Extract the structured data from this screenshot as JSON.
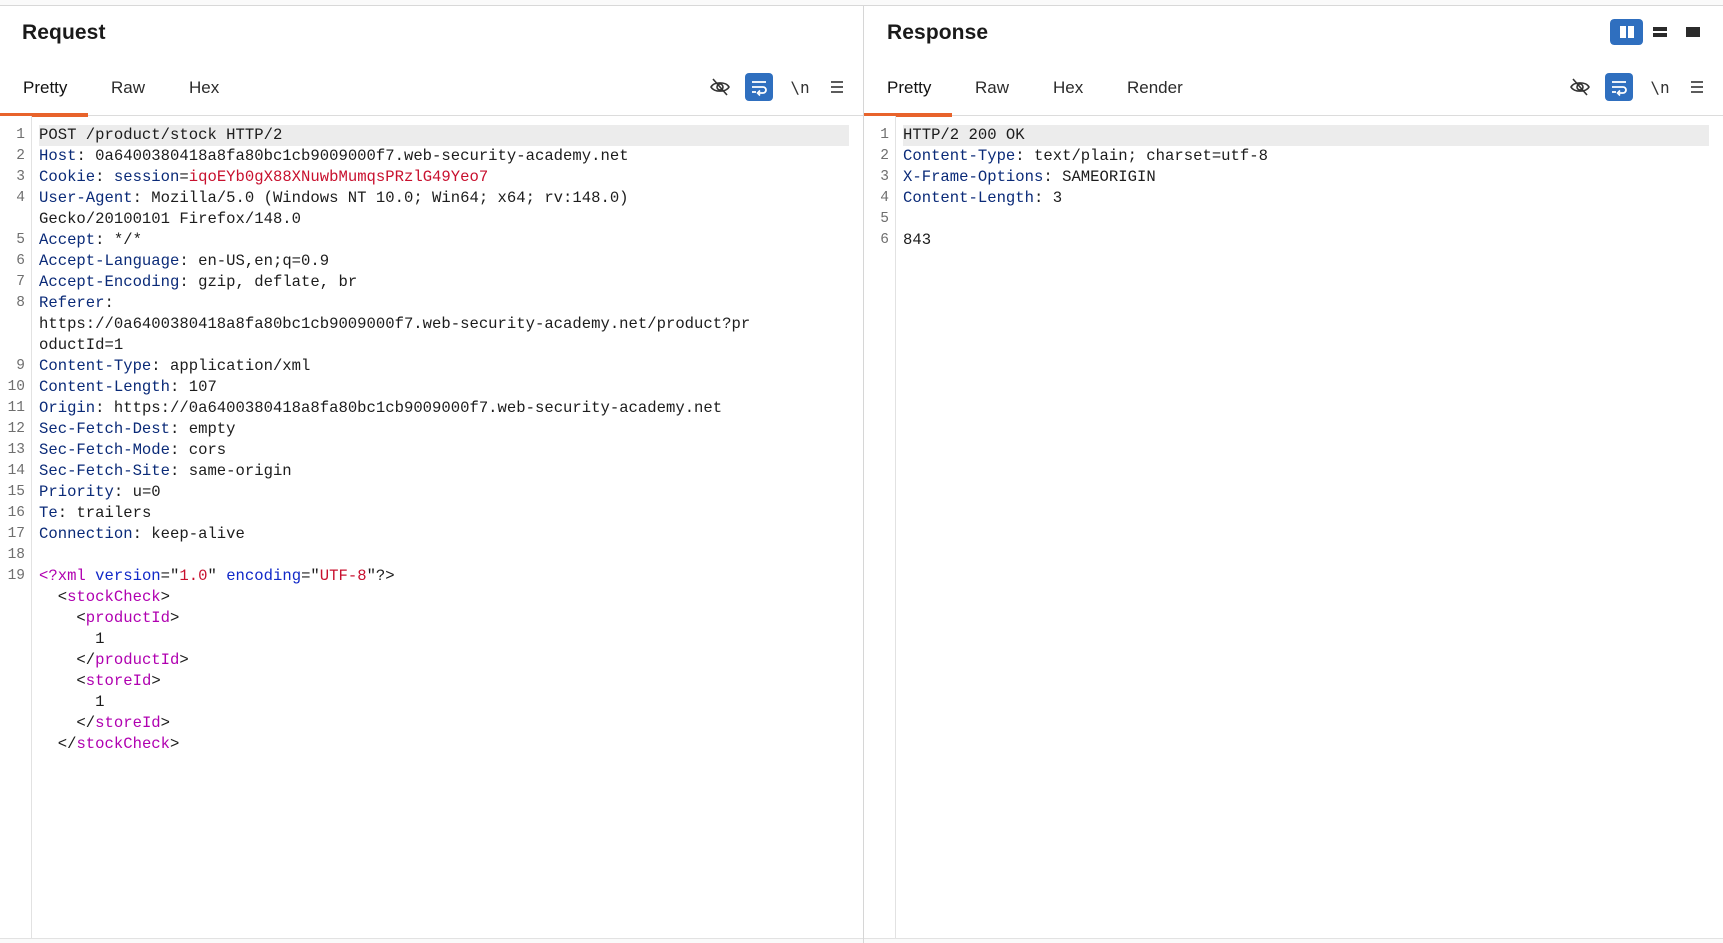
{
  "request": {
    "title": "Request",
    "tabs": [
      {
        "label": "Pretty",
        "active": true
      },
      {
        "label": "Raw",
        "active": false
      },
      {
        "label": "Hex",
        "active": false
      }
    ],
    "tools": {
      "newline_label": "\\n"
    },
    "lines": [
      {
        "n": "1",
        "parts": [
          {
            "t": "POST /product/stock HTTP/2",
            "c": "hval"
          }
        ]
      },
      {
        "n": "2",
        "parts": [
          {
            "t": "Host",
            "c": "hname"
          },
          {
            "t": ": ",
            "c": "punct"
          },
          {
            "t": "0a6400380418a8fa80bc1cb9009000f7.web-security-academy.net",
            "c": "hval"
          }
        ]
      },
      {
        "n": "3",
        "parts": [
          {
            "t": "Cookie",
            "c": "hname"
          },
          {
            "t": ": ",
            "c": "punct"
          },
          {
            "t": "session",
            "c": "hname"
          },
          {
            "t": "=",
            "c": "punct"
          },
          {
            "t": "iqoEYb0gX88XNuwbMumqsPRzlG49Yeo7",
            "c": "red"
          }
        ]
      },
      {
        "n": "4",
        "parts": [
          {
            "t": "User-Agent",
            "c": "hname"
          },
          {
            "t": ": ",
            "c": "punct"
          },
          {
            "t": "Mozilla/5.0 (Windows NT 10.0; Win64; x64; rv:148.0)",
            "c": "hval"
          }
        ]
      },
      {
        "n": "",
        "parts": [
          {
            "t": "Gecko/20100101 Firefox/148.0",
            "c": "hval"
          }
        ]
      },
      {
        "n": "5",
        "parts": [
          {
            "t": "Accept",
            "c": "hname"
          },
          {
            "t": ": ",
            "c": "punct"
          },
          {
            "t": "*/*",
            "c": "hval"
          }
        ]
      },
      {
        "n": "6",
        "parts": [
          {
            "t": "Accept-Language",
            "c": "hname"
          },
          {
            "t": ": ",
            "c": "punct"
          },
          {
            "t": "en-US,en;q=0.9",
            "c": "hval"
          }
        ]
      },
      {
        "n": "7",
        "parts": [
          {
            "t": "Accept-Encoding",
            "c": "hname"
          },
          {
            "t": ": ",
            "c": "punct"
          },
          {
            "t": "gzip, deflate, br",
            "c": "hval"
          }
        ]
      },
      {
        "n": "8",
        "parts": [
          {
            "t": "Referer",
            "c": "hname"
          },
          {
            "t": ":",
            "c": "punct"
          }
        ]
      },
      {
        "n": "",
        "parts": [
          {
            "t": "https://0a6400380418a8fa80bc1cb9009000f7.web-security-academy.net/product?pr",
            "c": "hval"
          }
        ]
      },
      {
        "n": "",
        "parts": [
          {
            "t": "oductId=1",
            "c": "hval"
          }
        ]
      },
      {
        "n": "9",
        "parts": [
          {
            "t": "Content-Type",
            "c": "hname"
          },
          {
            "t": ": ",
            "c": "punct"
          },
          {
            "t": "application/xml",
            "c": "hval"
          }
        ]
      },
      {
        "n": "10",
        "parts": [
          {
            "t": "Content-Length",
            "c": "hname"
          },
          {
            "t": ": ",
            "c": "punct"
          },
          {
            "t": "107",
            "c": "hval"
          }
        ]
      },
      {
        "n": "11",
        "parts": [
          {
            "t": "Origin",
            "c": "hname"
          },
          {
            "t": ": ",
            "c": "punct"
          },
          {
            "t": "https://0a6400380418a8fa80bc1cb9009000f7.web-security-academy.net",
            "c": "hval"
          }
        ]
      },
      {
        "n": "12",
        "parts": [
          {
            "t": "Sec-Fetch-Dest",
            "c": "hname"
          },
          {
            "t": ": ",
            "c": "punct"
          },
          {
            "t": "empty",
            "c": "hval"
          }
        ]
      },
      {
        "n": "13",
        "parts": [
          {
            "t": "Sec-Fetch-Mode",
            "c": "hname"
          },
          {
            "t": ": ",
            "c": "punct"
          },
          {
            "t": "cors",
            "c": "hval"
          }
        ]
      },
      {
        "n": "14",
        "parts": [
          {
            "t": "Sec-Fetch-Site",
            "c": "hname"
          },
          {
            "t": ": ",
            "c": "punct"
          },
          {
            "t": "same-origin",
            "c": "hval"
          }
        ]
      },
      {
        "n": "15",
        "parts": [
          {
            "t": "Priority",
            "c": "hname"
          },
          {
            "t": ": ",
            "c": "punct"
          },
          {
            "t": "u=0",
            "c": "hval"
          }
        ]
      },
      {
        "n": "16",
        "parts": [
          {
            "t": "Te",
            "c": "hname"
          },
          {
            "t": ": ",
            "c": "punct"
          },
          {
            "t": "trailers",
            "c": "hval"
          }
        ]
      },
      {
        "n": "17",
        "parts": [
          {
            "t": "Connection",
            "c": "hname"
          },
          {
            "t": ": ",
            "c": "punct"
          },
          {
            "t": "keep-alive",
            "c": "hval"
          }
        ]
      },
      {
        "n": "18",
        "parts": []
      },
      {
        "n": "19",
        "parts": [
          {
            "t": "<?xml ",
            "c": "tag"
          },
          {
            "t": "version",
            "c": "attr"
          },
          {
            "t": "=\"",
            "c": "punct"
          },
          {
            "t": "1.0",
            "c": "red"
          },
          {
            "t": "\" ",
            "c": "punct"
          },
          {
            "t": "encoding",
            "c": "attr"
          },
          {
            "t": "=\"",
            "c": "punct"
          },
          {
            "t": "UTF-8",
            "c": "red"
          },
          {
            "t": "\"?>",
            "c": "punct"
          }
        ]
      },
      {
        "n": "",
        "parts": [
          {
            "t": "  <",
            "c": "punct"
          },
          {
            "t": "stockCheck",
            "c": "tag"
          },
          {
            "t": ">",
            "c": "punct"
          }
        ]
      },
      {
        "n": "",
        "parts": [
          {
            "t": "    <",
            "c": "punct"
          },
          {
            "t": "productId",
            "c": "tag"
          },
          {
            "t": ">",
            "c": "punct"
          }
        ]
      },
      {
        "n": "",
        "parts": [
          {
            "t": "      1",
            "c": "hval"
          }
        ]
      },
      {
        "n": "",
        "parts": [
          {
            "t": "    </",
            "c": "punct"
          },
          {
            "t": "productId",
            "c": "tag"
          },
          {
            "t": ">",
            "c": "punct"
          }
        ]
      },
      {
        "n": "",
        "parts": [
          {
            "t": "    <",
            "c": "punct"
          },
          {
            "t": "storeId",
            "c": "tag"
          },
          {
            "t": ">",
            "c": "punct"
          }
        ]
      },
      {
        "n": "",
        "parts": [
          {
            "t": "      1",
            "c": "hval"
          }
        ]
      },
      {
        "n": "",
        "parts": [
          {
            "t": "    </",
            "c": "punct"
          },
          {
            "t": "storeId",
            "c": "tag"
          },
          {
            "t": ">",
            "c": "punct"
          }
        ]
      },
      {
        "n": "",
        "parts": [
          {
            "t": "  </",
            "c": "punct"
          },
          {
            "t": "stockCheck",
            "c": "tag"
          },
          {
            "t": ">",
            "c": "punct"
          }
        ]
      }
    ]
  },
  "response": {
    "title": "Response",
    "tabs": [
      {
        "label": "Pretty",
        "active": true
      },
      {
        "label": "Raw",
        "active": false
      },
      {
        "label": "Hex",
        "active": false
      },
      {
        "label": "Render",
        "active": false
      }
    ],
    "tools": {
      "newline_label": "\\n"
    },
    "lines": [
      {
        "n": "1",
        "parts": [
          {
            "t": "HTTP/2 200 OK",
            "c": "hval"
          }
        ]
      },
      {
        "n": "2",
        "parts": [
          {
            "t": "Content-Type",
            "c": "hname"
          },
          {
            "t": ": ",
            "c": "punct"
          },
          {
            "t": "text/plain; charset=utf-8",
            "c": "hval"
          }
        ]
      },
      {
        "n": "3",
        "parts": [
          {
            "t": "X-Frame-Options",
            "c": "hname"
          },
          {
            "t": ": ",
            "c": "punct"
          },
          {
            "t": "SAMEORIGIN",
            "c": "hval"
          }
        ]
      },
      {
        "n": "4",
        "parts": [
          {
            "t": "Content-Length",
            "c": "hname"
          },
          {
            "t": ": ",
            "c": "punct"
          },
          {
            "t": "3",
            "c": "hval"
          }
        ]
      },
      {
        "n": "5",
        "parts": []
      },
      {
        "n": "6",
        "parts": [
          {
            "t": "843",
            "c": "hval"
          }
        ]
      }
    ]
  },
  "layout_toggle": {
    "options": [
      "side-by-side",
      "stacked",
      "single"
    ],
    "selected": "side-by-side"
  },
  "colors": {
    "accent": "#e8632b",
    "active_tool": "#2f6fbf"
  }
}
